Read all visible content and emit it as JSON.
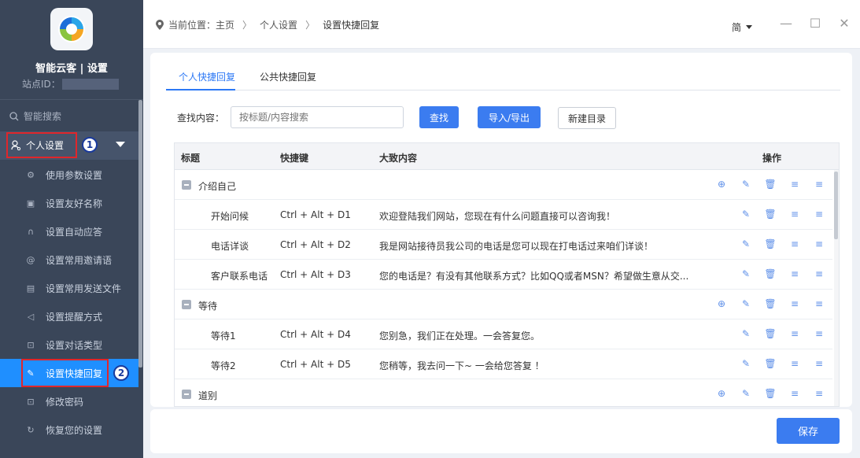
{
  "app": {
    "title": "智能云客 | 设置",
    "site_id_label": "站点ID："
  },
  "sidebar": {
    "search_label": "智能搜索",
    "group_label": "个人设置",
    "badge1": "1",
    "badge2": "2",
    "items": [
      {
        "label": "使用参数设置",
        "icon": "sliders-icon"
      },
      {
        "label": "设置友好名称",
        "icon": "tag-icon"
      },
      {
        "label": "设置自动应答",
        "icon": "headset-icon"
      },
      {
        "label": "设置常用邀请语",
        "icon": "at-icon"
      },
      {
        "label": "设置常用发送文件",
        "icon": "file-icon"
      },
      {
        "label": "设置提醒方式",
        "icon": "bell-icon"
      },
      {
        "label": "设置对话类型",
        "icon": "lock-icon"
      },
      {
        "label": "设置快捷回复",
        "icon": "edit-icon"
      },
      {
        "label": "修改密码",
        "icon": "lock-icon"
      },
      {
        "label": "恢复您的设置",
        "icon": "refresh-icon"
      }
    ]
  },
  "topbar": {
    "location_prefix": "当前位置：",
    "crumb1": "主页",
    "crumb2": "个人设置",
    "crumb3": "设置快捷回复",
    "lang": "简"
  },
  "tabs": [
    "个人快捷回复",
    "公共快捷回复"
  ],
  "search": {
    "label": "查找内容：",
    "placeholder": "按标题/内容搜索",
    "find_btn": "查找",
    "import_btn": "导入/导出",
    "newdir_btn": "新建目录"
  },
  "table": {
    "headers": [
      "标题",
      "快捷键",
      "大致内容",
      "操作"
    ],
    "rows": [
      {
        "type": "group",
        "title": "介绍自己"
      },
      {
        "type": "item",
        "title": "开始问候",
        "key": "Ctrl + Alt + D1",
        "content": "欢迎登陆我们网站，您现在有什么问题直接可以咨询我！"
      },
      {
        "type": "item",
        "title": "电话详谈",
        "key": "Ctrl + Alt + D2",
        "content": "我是网站接待员我公司的电话是您可以现在打电话过来咱们详谈！"
      },
      {
        "type": "item",
        "title": "客户联系电话",
        "key": "Ctrl + Alt + D3",
        "content": "您的电话是？有没有其他联系方式？比如QQ或者MSN？希望做生意从交..."
      },
      {
        "type": "group",
        "title": "等待"
      },
      {
        "type": "item",
        "title": "等待1",
        "key": "Ctrl + Alt + D4",
        "content": "您别急，我们正在处理。一会答复您。"
      },
      {
        "type": "item",
        "title": "等待2",
        "key": "Ctrl + Alt + D5",
        "content": "您稍等，我去问一下~ 一会给您答复 ！"
      },
      {
        "type": "group",
        "title": "道别"
      }
    ]
  },
  "footer": {
    "save_btn": "保存"
  },
  "colors": {
    "sidebar_bg": "#3a4659",
    "active_blue": "#1f8fff",
    "primary_btn": "#3b7cf0",
    "annotation_red": "#e0262b"
  }
}
